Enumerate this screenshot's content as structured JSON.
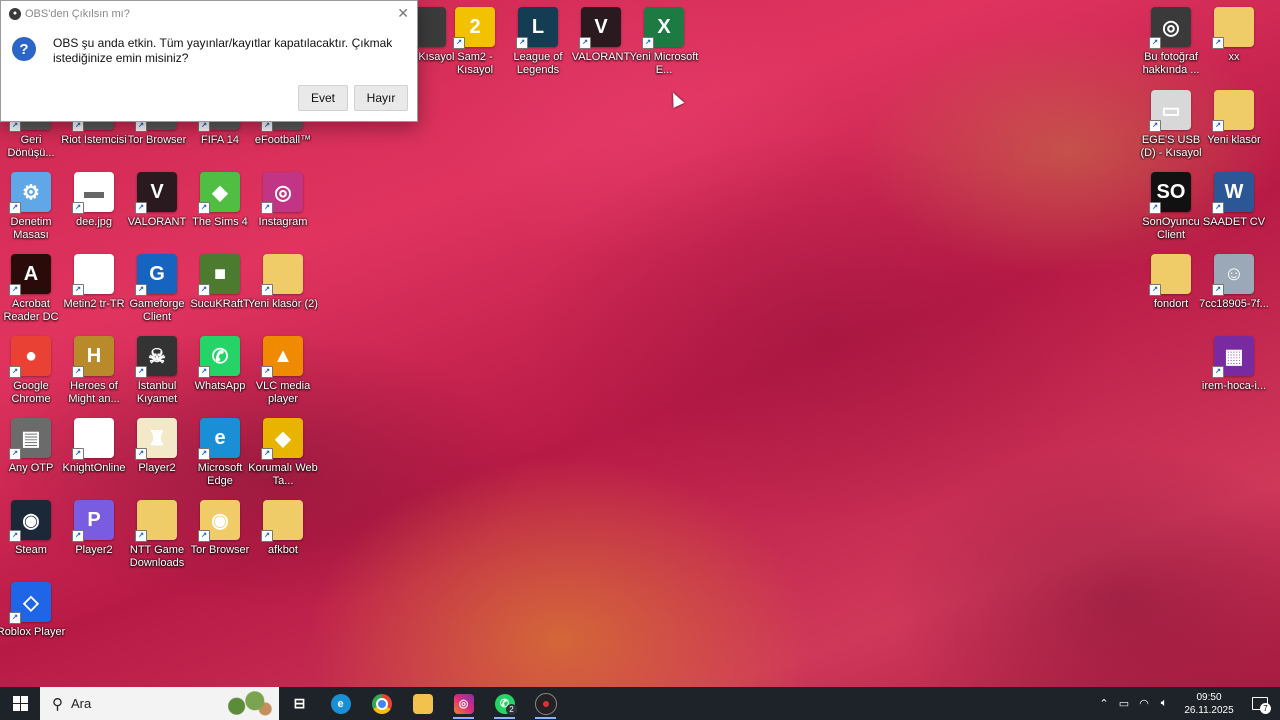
{
  "dialog": {
    "title": "OBS'den Çıkılsın mı?",
    "message": "OBS şu anda etkin. Tüm yayınlar/kayıtlar kapatılacaktır. Çıkmak istediğinize emin misiniz?",
    "yes_label": "Evet",
    "no_label": "Hayır"
  },
  "desktop": {
    "top_row": [
      {
        "label": "ID - Kısayol",
        "icon": "id-app-icon",
        "color": "#3b3b3b",
        "glyph": ""
      },
      {
        "label": "Sam2 - Kısayol",
        "icon": "sam2-icon",
        "color": "#f2c200",
        "glyph": "2"
      },
      {
        "label": "League of Legends",
        "icon": "league-of-legends-icon",
        "color": "#143c52",
        "glyph": "L"
      },
      {
        "label": "VALORANT",
        "icon": "valorant-icon",
        "color": "#2a1a1f",
        "glyph": "V"
      },
      {
        "label": "Yeni Microsoft E...",
        "icon": "excel-file-icon",
        "color": "#1d7a43",
        "glyph": "X"
      }
    ],
    "row2": [
      {
        "label": "Geri Dönüşü...",
        "icon": "recycle-bin-icon"
      },
      {
        "label": "Riot İstemcisi",
        "icon": "riot-client-icon"
      },
      {
        "label": "Tor Browser",
        "icon": "tor-browser-icon"
      },
      {
        "label": "FIFA 14",
        "icon": "fifa-14-icon"
      },
      {
        "label": "eFootball™",
        "icon": "efootball-icon"
      }
    ],
    "col_left": [
      {
        "label": "Denetim Masası",
        "icon": "control-panel-icon",
        "color": "#5fa7e6",
        "glyph": "⚙"
      },
      {
        "label": "dee.jpg",
        "icon": "image-file-icon",
        "color": "#ffffff",
        "glyph": "▬"
      },
      {
        "label": "VALORANT",
        "icon": "valorant-icon",
        "color": "#2a1a1f",
        "glyph": "V"
      },
      {
        "label": "The Sims 4",
        "icon": "sims-4-icon",
        "color": "#4fbe43",
        "glyph": "◆"
      },
      {
        "label": "Instagram",
        "icon": "instagram-icon",
        "color": "#c13584",
        "glyph": "◎"
      },
      {
        "label": "Acrobat Reader DC",
        "icon": "acrobat-reader-icon",
        "color": "#2b0a0a",
        "glyph": "A"
      },
      {
        "label": "Metin2 tr-TR",
        "icon": "metin2-file-icon",
        "color": "#ffffff",
        "glyph": ""
      },
      {
        "label": "Gameforge Client",
        "icon": "gameforge-client-icon",
        "color": "#1565c0",
        "glyph": "G"
      },
      {
        "label": "SucuKRaftT",
        "icon": "minecraft-icon",
        "color": "#4c7a2e",
        "glyph": "■"
      },
      {
        "label": "Yeni klasör (2)",
        "icon": "folder-icon",
        "color": "#f0cc68",
        "glyph": ""
      },
      {
        "label": "Google Chrome",
        "icon": "chrome-icon",
        "color": "#e94235",
        "glyph": "●"
      },
      {
        "label": "Heroes of Might an...",
        "icon": "heroes-icon",
        "color": "#b88a2a",
        "glyph": "H"
      },
      {
        "label": "İstanbul Kıyamet Vak...",
        "icon": "istanbul-kiyamet-icon",
        "color": "#333",
        "glyph": "☠"
      },
      {
        "label": "WhatsApp",
        "icon": "whatsapp-icon",
        "color": "#25d366",
        "glyph": "✆"
      },
      {
        "label": "VLC media player",
        "icon": "vlc-icon",
        "color": "#f08a00",
        "glyph": "▲"
      },
      {
        "label": "Any OTP",
        "icon": "any-otp-icon",
        "color": "#6b6b6b",
        "glyph": "▤"
      },
      {
        "label": "KnightOnline",
        "icon": "knightonline-file-icon",
        "color": "#ffffff",
        "glyph": ""
      },
      {
        "label": "Player2",
        "icon": "player2-file-icon",
        "color": "#f3e9c9",
        "glyph": "♜"
      },
      {
        "label": "Microsoft Edge",
        "icon": "edge-icon",
        "color": "#1a8fd6",
        "glyph": "e"
      },
      {
        "label": "Korumalı Web Ta...",
        "icon": "protected-web-icon",
        "color": "#e8b400",
        "glyph": "◆"
      },
      {
        "label": "Steam",
        "icon": "steam-icon",
        "color": "#1b2838",
        "glyph": "◉"
      },
      {
        "label": "Player2",
        "icon": "player2-icon",
        "color": "#7a5ce0",
        "glyph": "P"
      },
      {
        "label": "NTT Game Downloads",
        "icon": "ntt-downloads-icon",
        "color": "#f0cc68",
        "glyph": ""
      },
      {
        "label": "Tor Browser",
        "icon": "tor-browser-folder-icon",
        "color": "#f0cc68",
        "glyph": "◉"
      },
      {
        "label": "afkbot",
        "icon": "afkbot-icon",
        "color": "#f0cc68",
        "glyph": ""
      },
      {
        "label": "Roblox Player",
        "icon": "roblox-icon",
        "color": "#1f65e8",
        "glyph": "◇"
      }
    ],
    "right": [
      {
        "label": "Bu fotoğraf hakkında ...",
        "icon": "photo-info-icon",
        "color": "#3a3a3a",
        "glyph": "◎"
      },
      {
        "label": "xx",
        "icon": "folder-icon",
        "color": "#f0cc68",
        "glyph": ""
      },
      {
        "label": "EGE'S USB (D) - Kısayol",
        "icon": "usb-drive-icon",
        "color": "#d8d8d8",
        "glyph": "▭"
      },
      {
        "label": "Yeni klasör",
        "icon": "folder-icon",
        "color": "#f0cc68",
        "glyph": ""
      },
      {
        "label": "SonOyuncu Client",
        "icon": "sonoyuncu-icon",
        "color": "#111",
        "glyph": "SO"
      },
      {
        "label": "SAADET CV",
        "icon": "word-file-icon",
        "color": "#2b5797",
        "glyph": "W"
      },
      {
        "label": "fondort",
        "icon": "folder-icon",
        "color": "#f0cc68",
        "glyph": ""
      },
      {
        "label": "7cc18905-7f...",
        "icon": "photo-file-icon",
        "color": "#9aa8b8",
        "glyph": "☺"
      },
      {
        "label": "irem-hoca-i...",
        "icon": "winrar-icon",
        "color": "#7a2aa0",
        "glyph": "▦"
      }
    ]
  },
  "taskbar": {
    "search_placeholder": "Ara",
    "time": "09:50",
    "date": "26.11.2025",
    "whatsapp_badge": "2",
    "notification_count": "7"
  }
}
